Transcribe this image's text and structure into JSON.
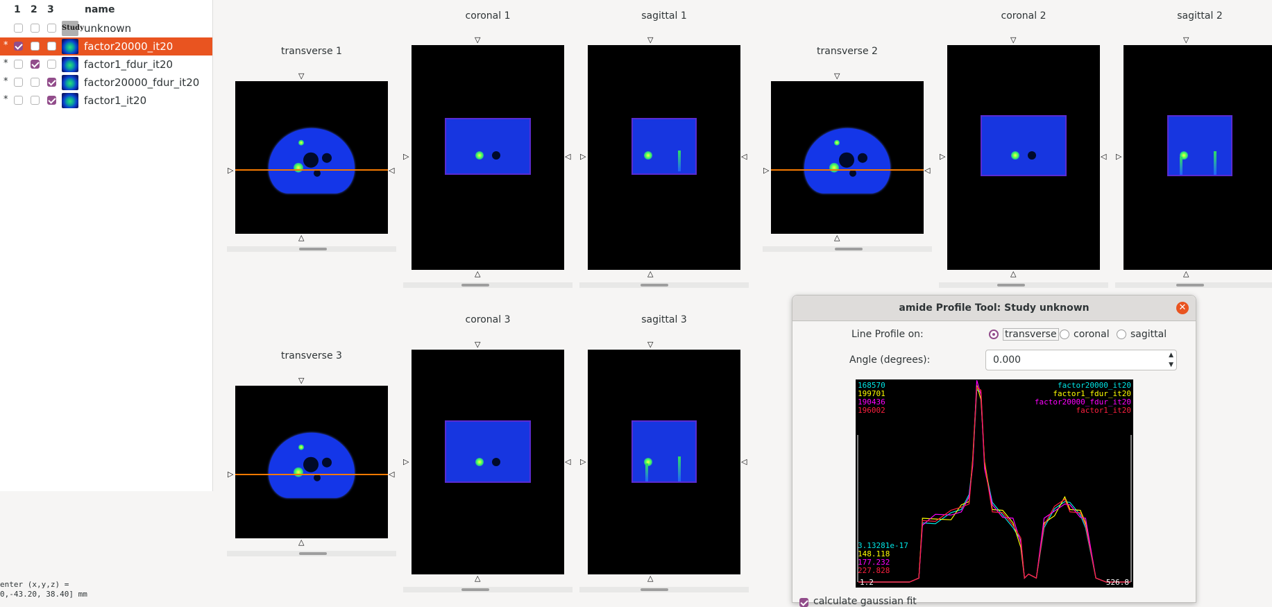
{
  "tree": {
    "headers": [
      "1",
      "2",
      "3",
      "name"
    ],
    "study": {
      "name": "unknown",
      "thumb_label": "Study"
    },
    "rows": [
      {
        "star": "*",
        "c1": true,
        "c2": false,
        "c3": false,
        "name": "factor20000_it20",
        "selected": true
      },
      {
        "star": "*",
        "c1": false,
        "c2": true,
        "c3": false,
        "name": "factor1_fdur_it20",
        "selected": false
      },
      {
        "star": "*",
        "c1": false,
        "c2": false,
        "c3": true,
        "name": "factor20000_fdur_it20",
        "selected": false
      },
      {
        "star": "*",
        "c1": false,
        "c2": false,
        "c3": true,
        "name": "factor1_it20",
        "selected": false
      }
    ]
  },
  "views": {
    "transverse1": "transverse 1",
    "coronal1": "coronal 1",
    "sagittal1": "sagittal 1",
    "transverse2": "transverse 2",
    "coronal2": "coronal 2",
    "sagittal2": "sagittal 2",
    "transverse3": "transverse 3",
    "coronal3": "coronal 3",
    "sagittal3": "sagittal 3"
  },
  "status": {
    "line1": "enter (x,y,z) =",
    "line2": "0,-43.20, 38.40] mm"
  },
  "dialog": {
    "title": "amide Profile Tool: Study unknown",
    "line_profile_label": "Line Profile on:",
    "options": [
      "transverse",
      "coronal",
      "sagittal"
    ],
    "selected_option": "transverse",
    "angle_label": "Angle (degrees):",
    "angle_value": "0.000",
    "gauss_label": "calculate gaussian fit"
  },
  "chart_data": {
    "type": "line",
    "x_min_label": "1.2",
    "x_max_label": "526.8",
    "xlim": [
      1.2,
      526.8
    ],
    "series": [
      {
        "name": "factor20000_it20",
        "color": "#00e5e5",
        "max_label": "168570",
        "min_label": "3.13281e-17"
      },
      {
        "name": "factor1_fdur_it20",
        "color": "#ffff00",
        "max_label": "199701",
        "min_label": "148.118"
      },
      {
        "name": "factor20000_fdur_it20",
        "color": "#ff00ff",
        "max_label": "190436",
        "min_label": "177.232"
      },
      {
        "name": "factor1_it20",
        "color": "#ff2040",
        "max_label": "196002",
        "min_label": "227.828"
      }
    ],
    "x": [
      1.2,
      60,
      100,
      118,
      125,
      150,
      180,
      200,
      215,
      222,
      230,
      238,
      245,
      260,
      280,
      300,
      315,
      322,
      330,
      345,
      360,
      380,
      400,
      410,
      430,
      440,
      460,
      480,
      526.8
    ],
    "profile": [
      0,
      0,
      0,
      0.02,
      0.3,
      0.32,
      0.34,
      0.38,
      0.42,
      0.6,
      1.0,
      0.95,
      0.6,
      0.38,
      0.34,
      0.3,
      0.2,
      0.02,
      0.04,
      0.02,
      0.3,
      0.36,
      0.42,
      0.38,
      0.34,
      0.3,
      0.02,
      0,
      0
    ]
  }
}
